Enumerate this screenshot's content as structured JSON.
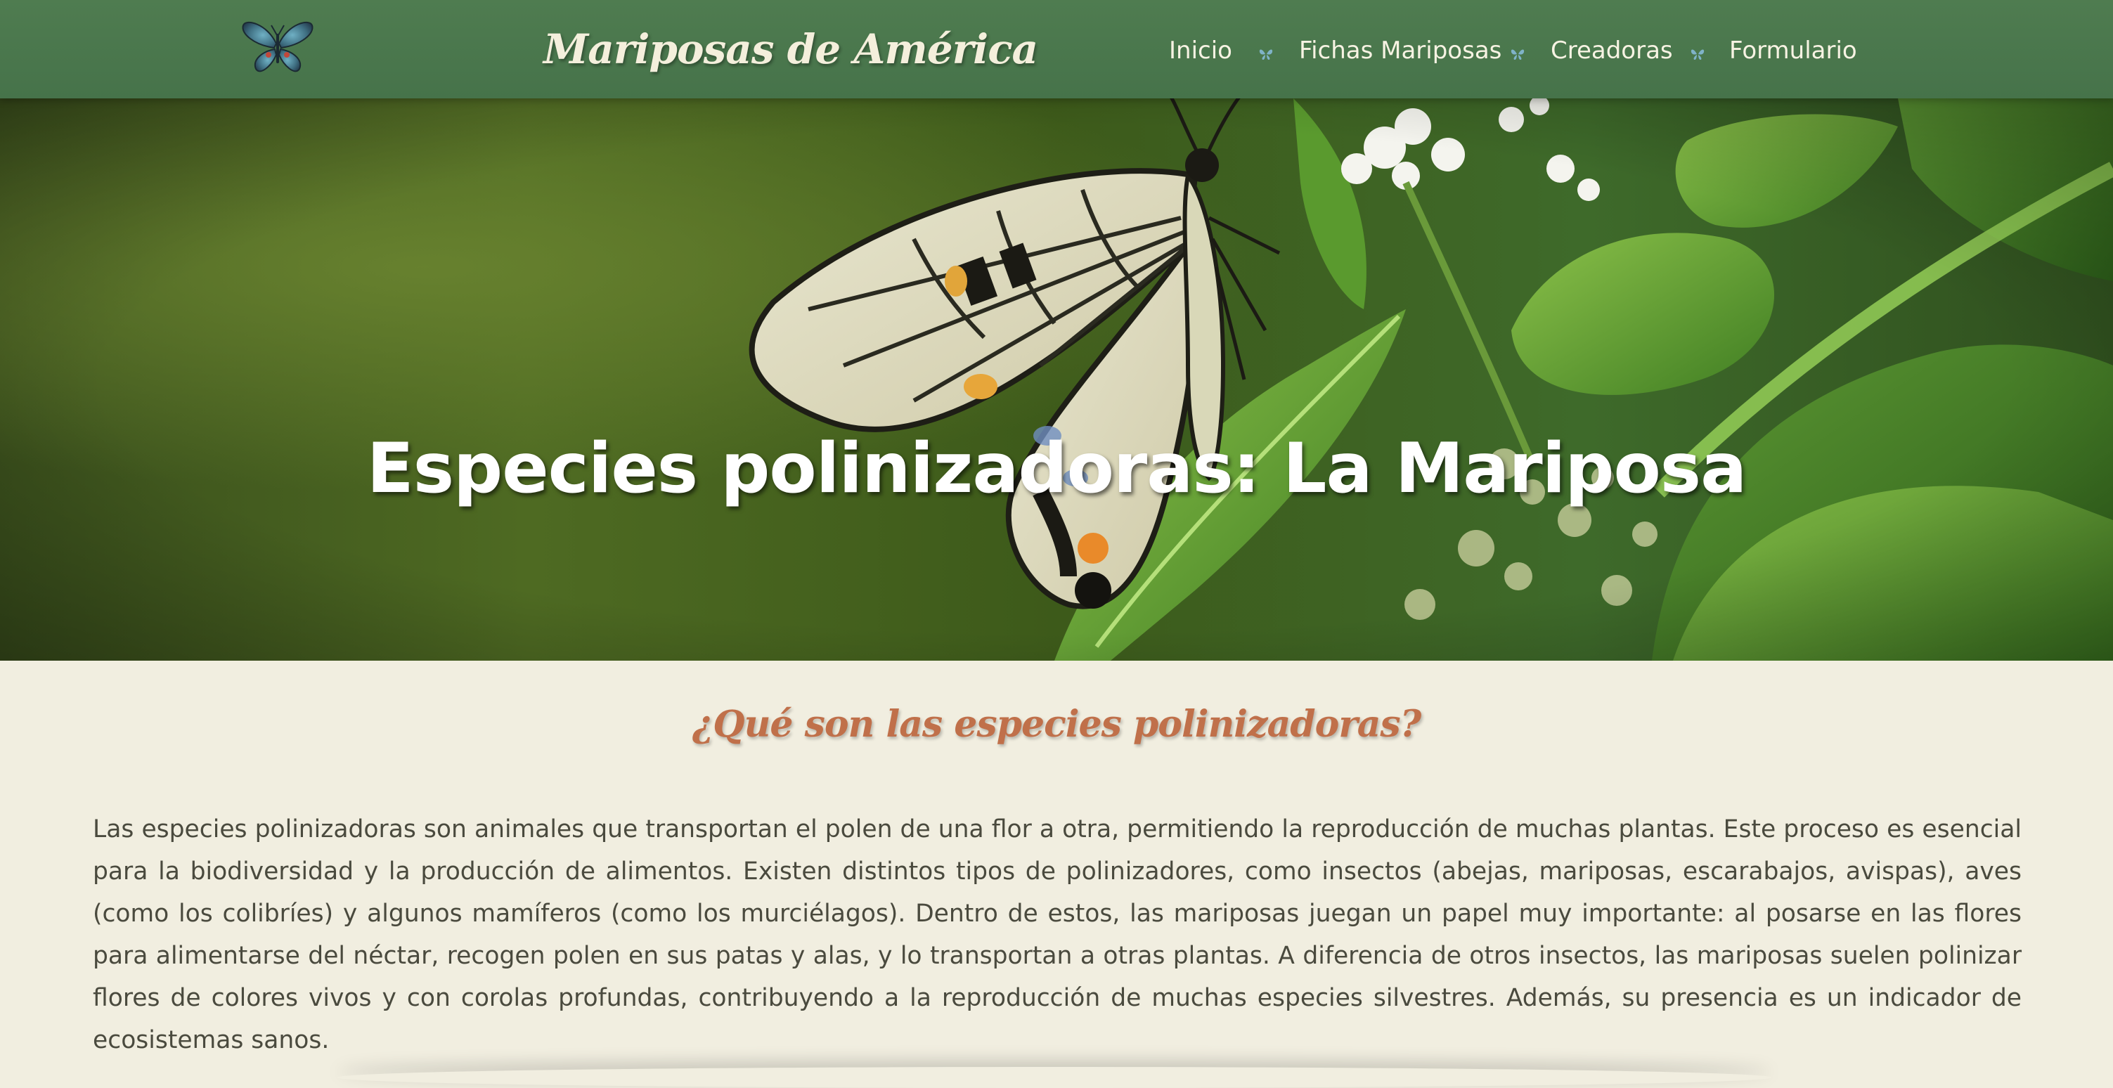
{
  "header": {
    "logo_icon": "butterfly-icon",
    "site_title": "Mariposas de América",
    "nav": [
      {
        "label": "Inicio"
      },
      {
        "label": "Fichas Mariposas"
      },
      {
        "label": "Creadoras"
      },
      {
        "label": "Formulario"
      }
    ],
    "separator_icon": "small-butterfly-icon"
  },
  "hero": {
    "title": "Especies polinizadoras: La Mariposa",
    "image": "swallowtail-butterfly-on-flowers-photo"
  },
  "content": {
    "heading": "¿Qué son las especies polinizadoras?",
    "paragraph": "Las especies polinizadoras son animales que transportan el polen de una flor a otra, permitiendo la reproducción de muchas plantas. Este proceso es esencial para la biodiversidad y la producción de alimentos. Existen distintos tipos de polinizadores, como insectos (abejas, mariposas, escarabajos, avispas), aves (como los colibríes) y algunos mamíferos (como los murciélagos). Dentro de estos, las mariposas juegan un papel muy importante: al posarse en las flores para alimentarse del néctar, recogen polen en sus patas y alas, y lo transportan a otras plantas. A diferencia de otros insectos, las mariposas suelen polinizar flores de colores vivos y con corolas profundas, contribuyendo a la reproducción de muchas especies silvestres. Además, su presencia es un indicador de ecosistemas sanos."
  },
  "colors": {
    "header_bg": "#4b784d",
    "page_bg": "#f1eee0",
    "heading": "#c0704a",
    "body_text": "#4a4a3e",
    "nav_text": "#f7f3e3"
  }
}
